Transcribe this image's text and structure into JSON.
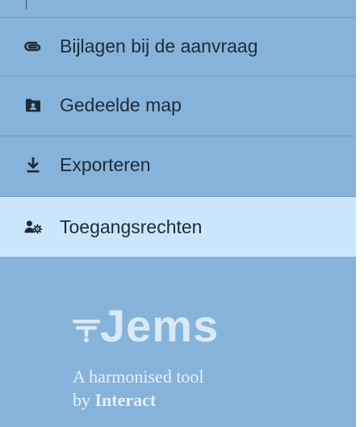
{
  "sidebar": {
    "items": [
      {
        "label": "Bijlagen bij de aanvraag",
        "icon": "paperclip-icon"
      },
      {
        "label": "Gedeelde map",
        "icon": "shared-folder-icon"
      },
      {
        "label": "Exporteren",
        "icon": "download-icon"
      },
      {
        "label": "Toegangsrechten",
        "icon": "user-settings-icon",
        "active": true
      }
    ],
    "colors": {
      "background": "#86b3da",
      "active_background": "#cbe6fa",
      "text": "#1f2b36",
      "divider": "#6f9cc4"
    }
  },
  "branding": {
    "logo_text": "Jems",
    "tagline_line1": "A harmonised tool",
    "tagline_line2_prefix": "by",
    "tagline_line2_brand": "Interact"
  }
}
